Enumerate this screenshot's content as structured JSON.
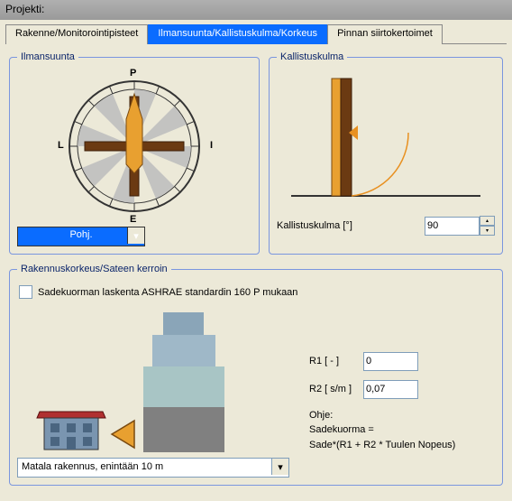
{
  "titlebar": {
    "project_label": "Projekti:"
  },
  "tabs": {
    "structure": "Rakenne/Monitorointipisteet",
    "direction": "Ilmansuunta/Kallistuskulma/Korkeus",
    "surface": "Pinnan siirtokertoimet"
  },
  "direction_group": {
    "legend": "Ilmansuunta",
    "p": "P",
    "i": "I",
    "e": "E",
    "l": "L",
    "dropdown_value": "Pohj."
  },
  "tilt_group": {
    "legend": "Kallistuskulma",
    "label": "Kallistuskulma [°]",
    "value": "90"
  },
  "height_group": {
    "legend": "Rakennuskorkeus/Sateen kerroin",
    "checkbox_label": "Sadekuorman laskenta ASHRAE standardin 160 P mukaan",
    "r1_label": "R1 [ - ]",
    "r1_value": "0",
    "r2_label": "R2 [ s/m ]",
    "r2_value": "0,07",
    "ohje_title": "Ohje:",
    "ohje_line1": "Sadekuorma =",
    "ohje_line2": "Sade*(R1 + R2 * Tuulen Nopeus)",
    "building_dropdown": "Matala rakennus, enintään 10 m"
  },
  "icons": {
    "chevron_down": "▾",
    "spin_up": "▴",
    "spin_down": "▾"
  }
}
